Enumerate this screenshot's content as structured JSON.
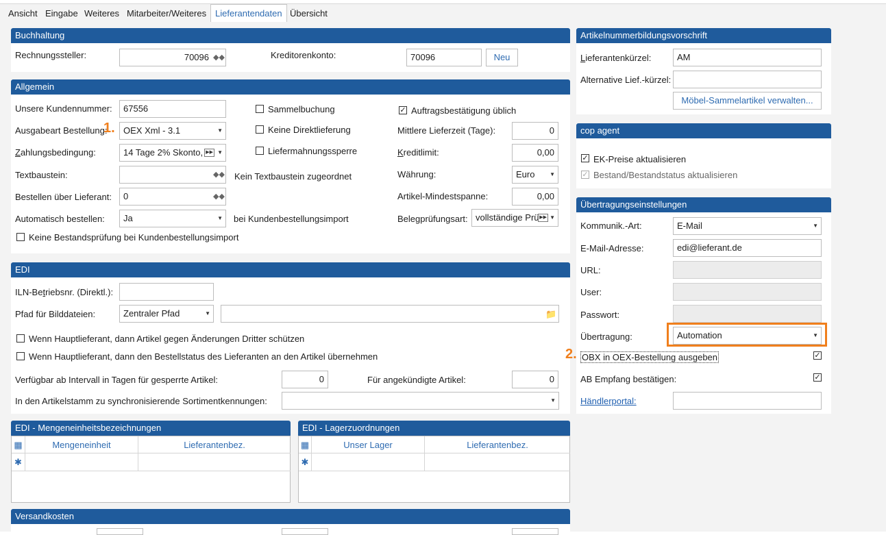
{
  "tabs": [
    "Ansicht",
    "Eingabe",
    "Weiteres",
    "Mitarbeiter/Weiteres",
    "Lieferantendaten",
    "Übersicht"
  ],
  "buchhaltung": {
    "title": "Buchhaltung",
    "rechnungssteller_label": "Rechnungssteller:",
    "rechnungssteller_value": "70096",
    "kreditorenkonto_label": "Kreditorenkonto:",
    "kreditorenkonto_value": "70096",
    "neu_button": "Neu"
  },
  "allgemein": {
    "title": "Allgemein",
    "kundennummer_label": "Unsere Kundennummer:",
    "kundennummer_value": "67556",
    "ausgabeart_label": "Ausgabeart Bestellung:",
    "ausgabeart_value": "OEX Xml - 3.1",
    "zahlung_label": "Zahlungsbedingung:",
    "zahlung_value": "14 Tage 2% Skonto,",
    "textbaustein_label": "Textbaustein:",
    "textbaustein_info": "Kein Textbaustein zugeordnet",
    "bestellen_label": "Bestellen über Lieferant:",
    "bestellen_value": "0",
    "automatisch_label": "Automatisch bestellen:",
    "automatisch_value": "Ja",
    "automatisch_info": "bei Kundenbestellungsimport",
    "keine_bestandspruefung": "Keine Bestandsprüfung bei Kundenbestellungsimport",
    "sammelbuchung": "Sammelbuchung",
    "keine_direktlieferung": "Keine Direktlieferung",
    "liefermahnungssperre": "Liefermahnungssperre",
    "auftragsbestaetigung": "Auftragsbestätigung üblich",
    "lieferzeit_label": "Mittlere Lieferzeit (Tage):",
    "lieferzeit_value": "0",
    "kreditlimit_label": "Kreditlimit:",
    "kreditlimit_value": "0,00",
    "waehrung_label": "Währung:",
    "waehrung_value": "Euro",
    "mindestspanne_label": "Artikel-Mindestspanne:",
    "mindestspanne_value": "0,00",
    "belegpruefung_label": "Belegprüfungsart:",
    "belegpruefung_value": "vollständige Prü"
  },
  "edi": {
    "title": "EDI",
    "iln_label": "ILN-Betriebsnr. (Direktl.):",
    "iln_value": "",
    "pfad_label": "Pfad für Bilddateien:",
    "pfad_value": "Zentraler Pfad",
    "schuetzen": "Wenn Hauptlieferant, dann Artikel gegen Änderungen Dritter schützen",
    "bestellstatus": "Wenn Hauptlieferant, dann den Bestellstatus des Lieferanten an den Artikel übernehmen",
    "verfuegbar_label": "Verfügbar ab Intervall in Tagen für gesperrte Artikel:",
    "verfuegbar_value": "0",
    "angekuendigt_label": "Für angekündigte Artikel:",
    "angekuendigt_value": "0",
    "sortiment_label": "In den Artikelstamm zu synchronisierende Sortimentkennungen:",
    "sortiment_value": ""
  },
  "mengeneinheiten": {
    "title": "EDI - Mengeneinheitsbezeichnungen",
    "col1": "Mengeneinheit",
    "col2": "Lieferantenbez."
  },
  "lager": {
    "title": "EDI - Lagerzuordnungen",
    "col1": "Unser Lager",
    "col2": "Lieferantenbez."
  },
  "versand": {
    "title": "Versandkosten"
  },
  "artikelnummer": {
    "title": "Artikelnummerbildungsvorschrift",
    "kuerzel_label": "Lieferantenkürzel:",
    "kuerzel_value": "AM",
    "alt_label": "Alternative Lief.-kürzel:",
    "alt_value": "",
    "moebel_button": "Möbel-Sammelartikel verwalten..."
  },
  "cop": {
    "title": "cop agent",
    "ek_preise": "EK-Preise aktualisieren",
    "bestand": "Bestand/Bestandstatus aktualisieren"
  },
  "uebertragung": {
    "title": "Übertragungseinstellungen",
    "kommunikation_label": "Kommunik.-Art:",
    "kommunikation_value": "E-Mail",
    "email_label": "E-Mail-Adresse:",
    "email_value": "edi@lieferant.de",
    "url_label": "URL:",
    "user_label": "User:",
    "passwort_label": "Passwort:",
    "uebertragung_label": "Übertragung:",
    "uebertragung_value": "Automation",
    "obx": "OBX in OEX-Bestellung ausgeben",
    "ab_empfang": "AB Empfang bestätigen:",
    "haendlerportal": "Händlerportal:",
    "haendlerportal_value": ""
  },
  "markers": {
    "one": "1.",
    "two": "2."
  },
  "colors": {
    "header": "#1f5b9c",
    "accent": "#2e6bb1",
    "annotation": "#f07f1c"
  }
}
